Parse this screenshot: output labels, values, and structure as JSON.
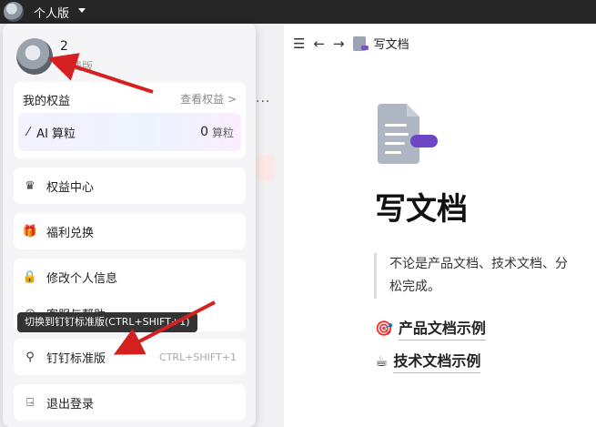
{
  "topbar": {
    "title": "个人版"
  },
  "profile": {
    "name": "2",
    "edition": "免费版"
  },
  "benefits": {
    "label": "我的权益",
    "link": "查看权益 >",
    "ai_label": "AI 算粒",
    "ai_count": "0",
    "ai_unit": "算粒"
  },
  "menu": {
    "center": "权益中心",
    "redeem": "福利兑换",
    "edit_info": "修改个人信息",
    "help": "客服与帮助",
    "switch": "钉钉标准版",
    "switch_shortcut": "CTRL+SHIFT+1",
    "logout": "退出登录"
  },
  "tooltip": "切换到钉钉标准版(CTRL+SHIFT+1)",
  "doc": {
    "breadcrumb": "写文档",
    "title": "写文档",
    "quote_line1": "不论是产品文档、技术文档、分",
    "quote_line2": "松完成。",
    "example1": "产品文档示例",
    "example2": "技术文档示例"
  },
  "colors": {
    "accent_arrow": "#d42020",
    "purple": "#6e45c4"
  }
}
